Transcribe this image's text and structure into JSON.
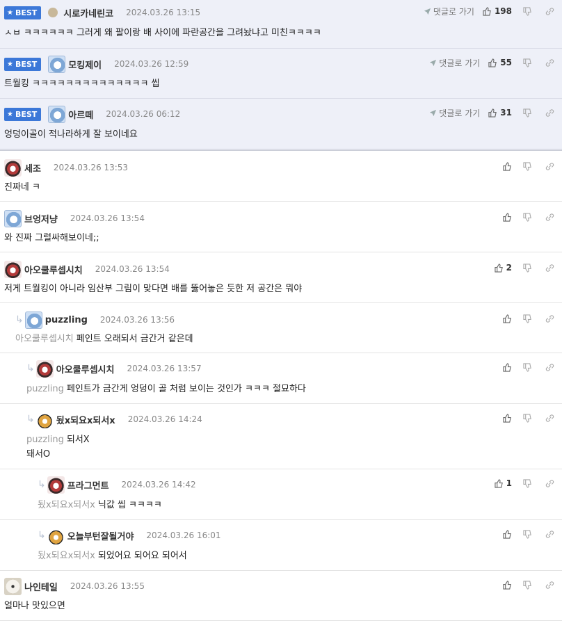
{
  "labels": {
    "best": "BEST",
    "goto": "댓글로 가기"
  },
  "comments": [
    {
      "nick": "시로카네린코",
      "date": "2024.03.26 13:15",
      "likes": "198",
      "text": "ㅅㅂ ㅋㅋㅋㅋㅋㅋ 그러게 왜 팔이랑 배 사이에 파란공간을 그려놨냐고 미친ㅋㅋㅋㅋ"
    },
    {
      "nick": "모킹제이",
      "date": "2024.03.26 12:59",
      "likes": "55",
      "text": "트월킹 ㅋㅋㅋㅋㅋㅋㅋㅋㅋㅋㅋㅋㅋㅋ 씹"
    },
    {
      "nick": "아르떼",
      "date": "2024.03.26 06:12",
      "likes": "31",
      "text": "엉덩이골이 적나라하게 잘 보이네요"
    },
    {
      "nick": "세조",
      "date": "2024.03.26 13:53",
      "likes": "",
      "text": "진짜네 ㅋ"
    },
    {
      "nick": "브엉저냥",
      "date": "2024.03.26 13:54",
      "likes": "",
      "text": "와 진짜 그럴싸해보이네;;"
    },
    {
      "nick": "아오쿨루셉시치",
      "date": "2024.03.26 13:54",
      "likes": "2",
      "text": "저게 트월킹이 아니라 임산부 그림이 맞다면 배를 뚫어놓은 듯한 저 공간은 뭐야"
    },
    {
      "nick": "puzzling",
      "date": "2024.03.26 13:56",
      "likes": "",
      "mention": "아오쿨루셉시치",
      "text": "페인트 오래되서 금간거 같은데"
    },
    {
      "nick": "아오쿨루셉시치",
      "date": "2024.03.26 13:57",
      "likes": "",
      "mention": "puzzling",
      "text": "페인트가 금간게 엉덩이 골 처럼 보이는 것인가 ㅋㅋㅋ 절묘하다"
    },
    {
      "nick": "됬x되요x되서x",
      "date": "2024.03.26 14:24",
      "likes": "",
      "mention": "puzzling",
      "text": "되서X",
      "text2": "돼서O"
    },
    {
      "nick": "프라그먼트",
      "date": "2024.03.26 14:42",
      "likes": "1",
      "mention": "됬x되요x되서x",
      "text": "닉값 씹 ㅋㅋㅋㅋ"
    },
    {
      "nick": "오늘부턴잘될거야",
      "date": "2024.03.26 16:01",
      "likes": "",
      "mention": "됬x되요x되서x",
      "text": "되었어요 되어요 되어서"
    },
    {
      "nick": "나인테일",
      "date": "2024.03.26 13:55",
      "likes": "",
      "text": "얼마나 맛있으면"
    }
  ]
}
